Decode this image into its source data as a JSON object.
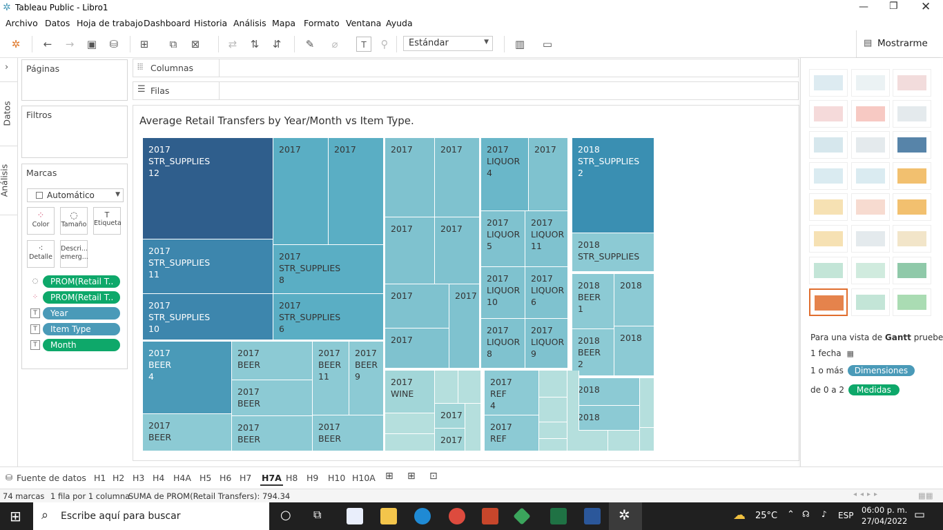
{
  "window": {
    "title": "Tableau Public - Libro1"
  },
  "menu": [
    "Archivo",
    "Datos",
    "Hoja de trabajo",
    "Dashboard",
    "Historia",
    "Análisis",
    "Mapa",
    "Formato",
    "Ventana",
    "Ayuda"
  ],
  "toolbar": {
    "standard_label": "Estándar",
    "show_me_label": "Mostrarme"
  },
  "side_tabs": {
    "data": "Datos",
    "analysis": "Análisis"
  },
  "cards": {
    "pages": "Páginas",
    "filters": "Filtros",
    "marks": "Marcas"
  },
  "marks": {
    "type": "Automático",
    "buttons": {
      "color": "Color",
      "size": "Tamaño",
      "label": "Etiqueta",
      "detail": "Detalle",
      "tooltip": "Descri... emerg..."
    },
    "fields": [
      {
        "label": "PROM(Retail T..",
        "color": "#0ea86a"
      },
      {
        "label": "PROM(Retail T..",
        "color": "#0ea86a"
      },
      {
        "label": "Year",
        "color": "#4a9ab8"
      },
      {
        "label": "Item Type",
        "color": "#4a9ab8"
      },
      {
        "label": "Month",
        "color": "#0ea86a"
      }
    ]
  },
  "shelves": {
    "columns": "Columnas",
    "rows": "Filas"
  },
  "chart": {
    "title": "Average Retail Transfers by Year/Month vs Item Type."
  },
  "chart_data": {
    "type": "treemap",
    "title": "Average Retail Transfers by Year/Month vs Item Type.",
    "cells": [
      {
        "year": "2017",
        "item_type": "STR_SUPPLIES",
        "month": "12"
      },
      {
        "year": "2017",
        "item_type": "STR_SUPPLIES",
        "month": "11"
      },
      {
        "year": "2017",
        "item_type": "STR_SUPPLIES",
        "month": "10"
      },
      {
        "year": "2017",
        "item_type": "STR_SUPPLIES",
        "month": "8"
      },
      {
        "year": "2017",
        "item_type": "STR_SUPPLIES",
        "month": "6"
      },
      {
        "year": "2017",
        "item_type": "",
        "month": ""
      },
      {
        "year": "2017",
        "item_type": "",
        "month": ""
      },
      {
        "year": "2017",
        "item_type": "BEER",
        "month": "4"
      },
      {
        "year": "2017",
        "item_type": "BEER",
        "month": ""
      },
      {
        "year": "2017",
        "item_type": "BEER",
        "month": ""
      },
      {
        "year": "2017",
        "item_type": "BEER",
        "month": "11"
      },
      {
        "year": "2017",
        "item_type": "BEER",
        "month": "9"
      },
      {
        "year": "2017",
        "item_type": "BEER",
        "month": ""
      },
      {
        "year": "2017",
        "item_type": "BEER",
        "month": ""
      },
      {
        "year": "2017",
        "item_type": "BEER",
        "month": ""
      },
      {
        "year": "2017",
        "item_type": "",
        "month": ""
      },
      {
        "year": "2017",
        "item_type": "",
        "month": ""
      },
      {
        "year": "2017",
        "item_type": "",
        "month": ""
      },
      {
        "year": "2017",
        "item_type": "",
        "month": ""
      },
      {
        "year": "2017",
        "item_type": "",
        "month": ""
      },
      {
        "year": "2017",
        "item_type": "",
        "month": ""
      },
      {
        "year": "2017",
        "item_type": "",
        "month": ""
      },
      {
        "year": "2017",
        "item_type": "LIQUOR",
        "month": "4"
      },
      {
        "year": "2017",
        "item_type": "",
        "month": ""
      },
      {
        "year": "2017",
        "item_type": "LIQUOR",
        "month": "5"
      },
      {
        "year": "2017",
        "item_type": "LIQUOR",
        "month": "11"
      },
      {
        "year": "2017",
        "item_type": "LIQUOR",
        "month": "10"
      },
      {
        "year": "2017",
        "item_type": "LIQUOR",
        "month": "6"
      },
      {
        "year": "2017",
        "item_type": "LIQUOR",
        "month": "8"
      },
      {
        "year": "2017",
        "item_type": "LIQUOR",
        "month": "9"
      },
      {
        "year": "2017",
        "item_type": "WINE",
        "month": ""
      },
      {
        "year": "2017",
        "item_type": "",
        "month": ""
      },
      {
        "year": "2017",
        "item_type": "",
        "month": ""
      },
      {
        "year": "2017",
        "item_type": "REF",
        "month": "4"
      },
      {
        "year": "2017",
        "item_type": "REF",
        "month": ""
      },
      {
        "year": "2018",
        "item_type": "STR_SUPPLIES",
        "month": "2"
      },
      {
        "year": "2018",
        "item_type": "STR_SUPPLIES",
        "month": ""
      },
      {
        "year": "2018",
        "item_type": "BEER",
        "month": "1"
      },
      {
        "year": "2018",
        "item_type": "",
        "month": ""
      },
      {
        "year": "2018",
        "item_type": "BEER",
        "month": "2"
      },
      {
        "year": "2018",
        "item_type": "",
        "month": ""
      },
      {
        "year": "2018",
        "item_type": "",
        "month": ""
      },
      {
        "year": "2018",
        "item_type": "",
        "month": ""
      }
    ]
  },
  "show_me": {
    "hint_prefix": "Para una vista de",
    "hint_chart": "Gantt",
    "hint_suffix": "pruebe",
    "req1": "1 fecha",
    "req2_prefix": "1 o más",
    "req2_badge": "Dimensiones",
    "req3_prefix": "de 0 a 2",
    "req3_badge": "Medidas"
  },
  "sheet_tabs": {
    "datasource": "Fuente de datos",
    "tabs": [
      "H1",
      "H2",
      "H3",
      "H4",
      "H4A",
      "H5",
      "H6",
      "H7",
      "H7A",
      "H8",
      "H9",
      "H10",
      "H10A"
    ],
    "active": "H7A"
  },
  "status": {
    "marks": "74 marcas",
    "rows": "1 fila por 1 columna",
    "sum": "SUMA de PROM(Retail Transfers): 794.34"
  },
  "taskbar": {
    "search_placeholder": "Escribe aquí para buscar",
    "weather": "25°C",
    "lang": "ESP",
    "time": "06:00 p. m.",
    "date": "27/04/2022"
  }
}
